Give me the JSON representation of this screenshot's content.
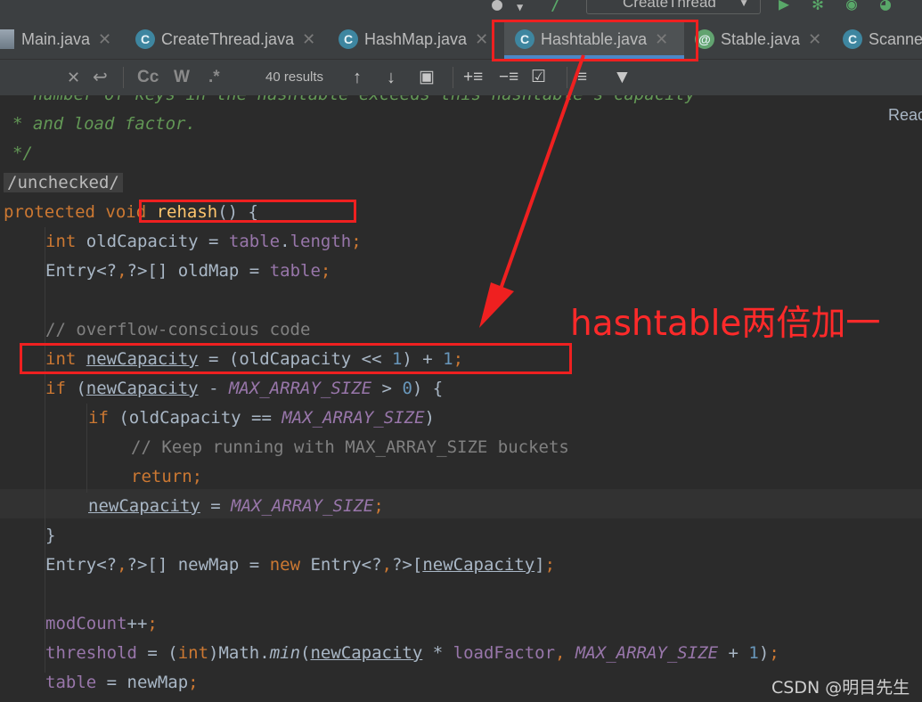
{
  "toolbar": {
    "run_config": "CreateThread"
  },
  "tabs": [
    {
      "label": "Main.java",
      "icon": "java-file-icon",
      "active": false
    },
    {
      "label": "CreateThread.java",
      "icon": "java-class-icon",
      "active": false
    },
    {
      "label": "HashMap.java",
      "icon": "java-class-locked-icon",
      "active": false
    },
    {
      "label": "Hashtable.java",
      "icon": "java-class-locked-icon",
      "active": true
    },
    {
      "label": "Stable.java",
      "icon": "java-annotation-icon",
      "active": false
    },
    {
      "label": "Scanne",
      "icon": "java-class-locked-icon",
      "active": false
    }
  ],
  "findbar": {
    "results": "40 results",
    "match_case": "Cc",
    "words": "W",
    "regex": ".*"
  },
  "editor": {
    "reader_mode": "Reac",
    "lines": [
      "* number of keys in the hashtable exceeds this hashtable's capacity",
      "* and load factor.",
      "*/",
      "/unchecked/",
      "protected void rehash() {",
      "int oldCapacity = table.length;",
      "Entry<?,?>[] oldMap = table;",
      "",
      "// overflow-conscious code",
      "int newCapacity = (oldCapacity << 1) + 1;",
      "if (newCapacity - MAX_ARRAY_SIZE > 0) {",
      "if (oldCapacity == MAX_ARRAY_SIZE)",
      "// Keep running with MAX_ARRAY_SIZE buckets",
      "return;",
      "newCapacity = MAX_ARRAY_SIZE;",
      "}",
      "Entry<?,?>[] newMap = new Entry<?,?>[newCapacity];",
      "",
      "modCount++;",
      "threshold = (int)Math.min(newCapacity * loadFactor, MAX_ARRAY_SIZE + 1);",
      "table = newMap;"
    ]
  },
  "annotation": {
    "callout": "hashtable两倍加一",
    "color": "#ef2020"
  },
  "watermark": "CSDN @明目先生"
}
